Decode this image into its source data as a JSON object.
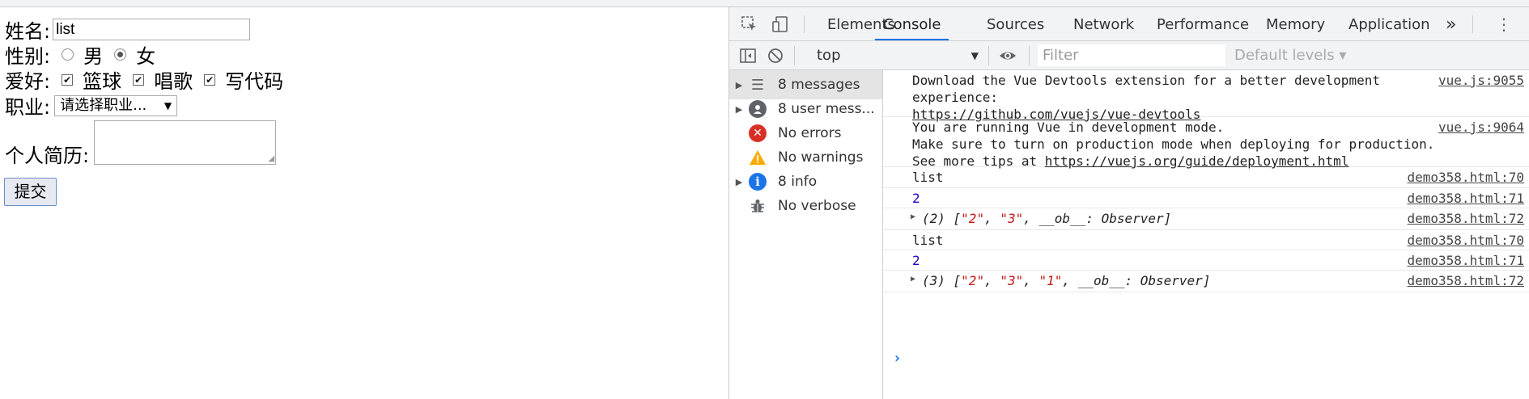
{
  "form": {
    "name_label": "姓名:",
    "name_value": "list",
    "gender_label": "性别:",
    "gender_options": [
      "男",
      "女"
    ],
    "gender_selected": "女",
    "hobby_label": "爱好:",
    "hobbies": [
      "篮球",
      "唱歌",
      "写代码"
    ],
    "job_label": "职业:",
    "job_select": "请选择职业...",
    "bio_label": "个人简历:",
    "submit_label": "提交"
  },
  "devtools": {
    "tabs": [
      "Elements",
      "Console",
      "Sources",
      "Network",
      "Performance",
      "Memory",
      "Application"
    ],
    "active_tab": "Console",
    "more_tabs": "»",
    "context": "top",
    "filter_placeholder": "Filter",
    "levels": "Default levels ▾",
    "sidebar": [
      {
        "label": "8 messages",
        "icon": "list-icon",
        "expandable": true
      },
      {
        "label": "8 user mess...",
        "icon": "user-icon",
        "expandable": true
      },
      {
        "label": "No errors",
        "icon": "error-icon",
        "expandable": false
      },
      {
        "label": "No warnings",
        "icon": "warning-icon",
        "expandable": false
      },
      {
        "label": "8 info",
        "icon": "info-icon",
        "expandable": true
      },
      {
        "label": "No verbose",
        "icon": "bug-icon",
        "expandable": false
      }
    ],
    "messages": {
      "m1_line1": "Download the Vue Devtools extension for a better development",
      "m1_line2": "experience:",
      "m1_link": "https://github.com/vuejs/vue-devtools",
      "m1_src": "vue.js:9055",
      "m2_line1": "You are running Vue in development mode.",
      "m2_line2": "Make sure to turn on production mode when deploying for production.",
      "m2_line3": "See more tips at ",
      "m2_link": "https://vuejs.org/guide/deployment.html",
      "m2_src": "vue.js:9064",
      "m3_text": "list",
      "m3_src": "demo358.html:70",
      "m4_text": "2",
      "m4_src": "demo358.html:71",
      "m5_count": "(2)",
      "m5_items": [
        "\"2\"",
        "\"3\""
      ],
      "m5_tail": "__ob__: Observer]",
      "m5_src": "demo358.html:72",
      "m6_text": "list",
      "m6_src": "demo358.html:70",
      "m7_text": "2",
      "m7_src": "demo358.html:71",
      "m8_count": "(3)",
      "m8_items": [
        "\"2\"",
        "\"3\"",
        "\"1\""
      ],
      "m8_tail": "__ob__: Observer]",
      "m8_src": "demo358.html:72"
    },
    "colors": {
      "accent": "#1a73e8",
      "error": "#d93025",
      "warning": "#f9ab00",
      "info": "#1a73e8"
    }
  }
}
